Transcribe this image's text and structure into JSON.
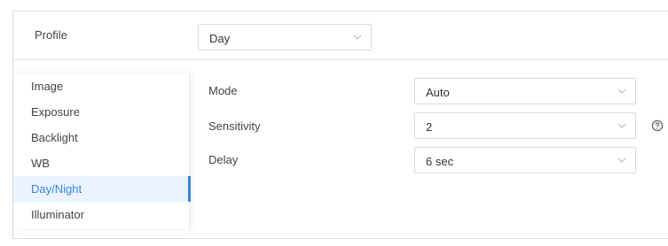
{
  "profile": {
    "label": "Profile",
    "value": "Day"
  },
  "menu": {
    "items": [
      {
        "label": "Image"
      },
      {
        "label": "Exposure"
      },
      {
        "label": "Backlight"
      },
      {
        "label": "WB"
      },
      {
        "label": "Day/Night",
        "active": true
      },
      {
        "label": "Illuminator"
      }
    ]
  },
  "settings": {
    "mode": {
      "label": "Mode",
      "value": "Auto"
    },
    "sensitivity": {
      "label": "Sensitivity",
      "value": "2"
    },
    "delay": {
      "label": "Delay",
      "value": "6 sec"
    }
  },
  "colors": {
    "accent": "#3a86d8",
    "active_bg": "#eaf3ff",
    "border": "#d9d9d9"
  },
  "icons": [
    "chevron-down-icon",
    "help-icon"
  ]
}
